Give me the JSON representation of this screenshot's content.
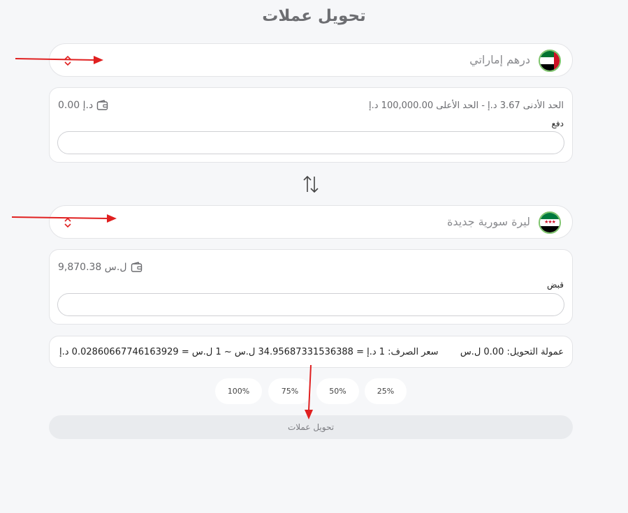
{
  "page_title": "تحويل عملات",
  "pay": {
    "currency_name": "درهم إماراتي",
    "limits": "الحد الأدنى 3.67 د.إ   -   الحد الأعلى 100,000.00 د.إ",
    "balance": "0.00 د.إ",
    "field_label": "دفع",
    "value": "",
    "flag_icon": "uae-flag-icon"
  },
  "receive": {
    "currency_name": "ليرة سورية جديدة",
    "balance": "9,870.38 ل.س",
    "field_label": "قبض",
    "value": "",
    "flag_icon": "syria-flag-icon"
  },
  "rate_info": {
    "commission": "عمولة التحويل: 0.00 ل.س",
    "rate": "سعر الصرف: 1 د.إ = 34.95687331536388 ل.س ~ 1 ل.س = 0.02860667746163929 د.إ"
  },
  "percent_buttons": [
    "100%",
    "75%",
    "50%",
    "25%"
  ],
  "convert_button": "تحويل عملات",
  "colors": {
    "annotation_arrow": "#e02020",
    "flag_border": "#7cc36a",
    "chevron": "#e02020"
  }
}
